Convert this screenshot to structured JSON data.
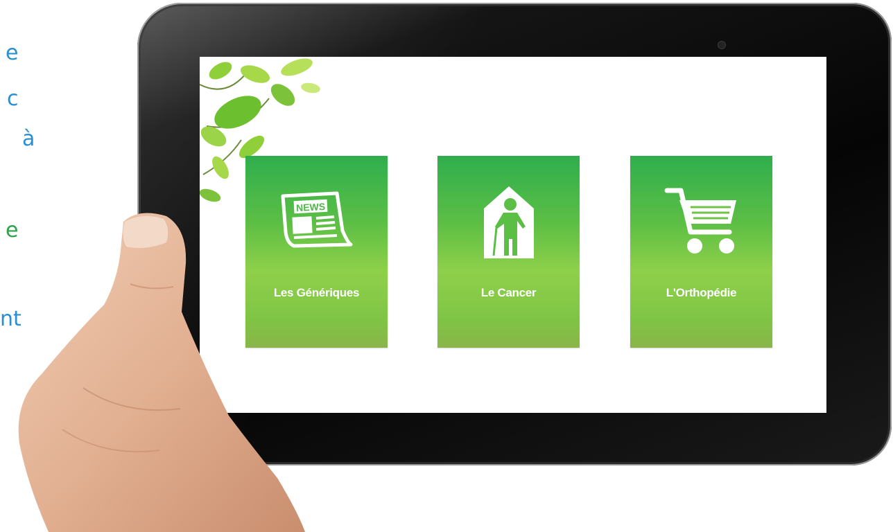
{
  "side_text": [
    {
      "text": "e",
      "color": "#2a8fd0"
    },
    {
      "text": "c",
      "color": "#2a8fd0"
    },
    {
      "text": "à",
      "color": "#2a8fd0"
    },
    {
      "text": "e",
      "color": "#2ca24a"
    },
    {
      "text": "nt",
      "color": "#2a8fd0"
    }
  ],
  "tiles": [
    {
      "label": "Les Génériques",
      "icon": "newspaper-icon",
      "icon_text": "NEWS"
    },
    {
      "label": "Le Cancer",
      "icon": "elderly-house-icon"
    },
    {
      "label": "L'Orthopédie",
      "icon": "shopping-cart-icon"
    }
  ],
  "colors": {
    "tile_green_top": "#2fae4d",
    "tile_green_mid": "#8fd04a",
    "side_blue": "#2a8fd0",
    "side_green": "#2ca24a"
  }
}
